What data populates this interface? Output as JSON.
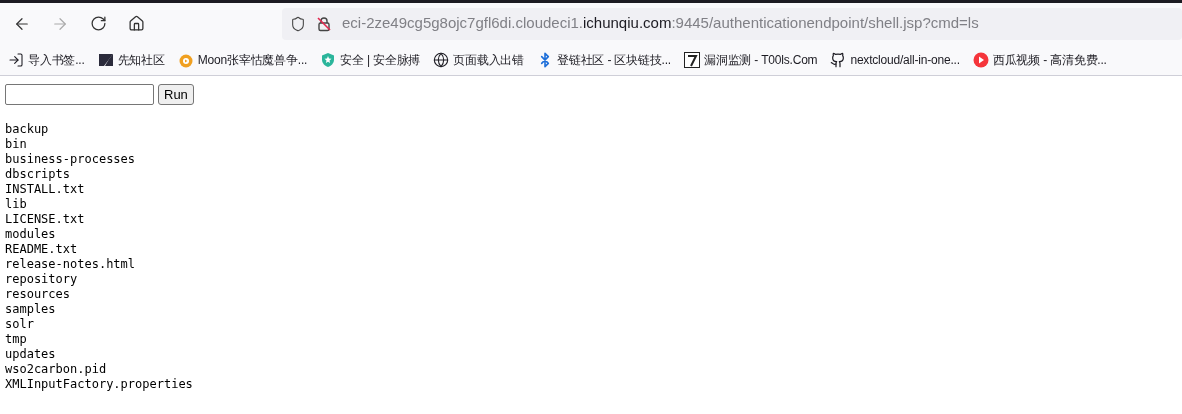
{
  "address_bar": {
    "url_prefix": "eci-2ze49cg5g8ojc7gfl6di.cloudeci1.",
    "url_domain": "ichunqiu.com",
    "url_suffix": ":9445/authenticationendpoint/shell.jsp?cmd=ls"
  },
  "bookmarks": [
    {
      "label": "导入书签..."
    },
    {
      "label": "先知社区"
    },
    {
      "label": "Moon张宰怙魔兽争..."
    },
    {
      "label": "安全 | 安全脉搏"
    },
    {
      "label": "页面载入出错"
    },
    {
      "label": "登链社区 - 区块链技..."
    },
    {
      "label": "漏洞监测 - T00ls.Com"
    },
    {
      "label": "nextcloud/all-in-one..."
    },
    {
      "label": "西瓜视频 - 高清免费..."
    }
  ],
  "form": {
    "button": "Run"
  },
  "output_lines": [
    "backup",
    "bin",
    "business-processes",
    "dbscripts",
    "INSTALL.txt",
    "lib",
    "LICENSE.txt",
    "modules",
    "README.txt",
    "release-notes.html",
    "repository",
    "resources",
    "samples",
    "solr",
    "tmp",
    "updates",
    "wso2carbon.pid",
    "XMLInputFactory.properties"
  ]
}
